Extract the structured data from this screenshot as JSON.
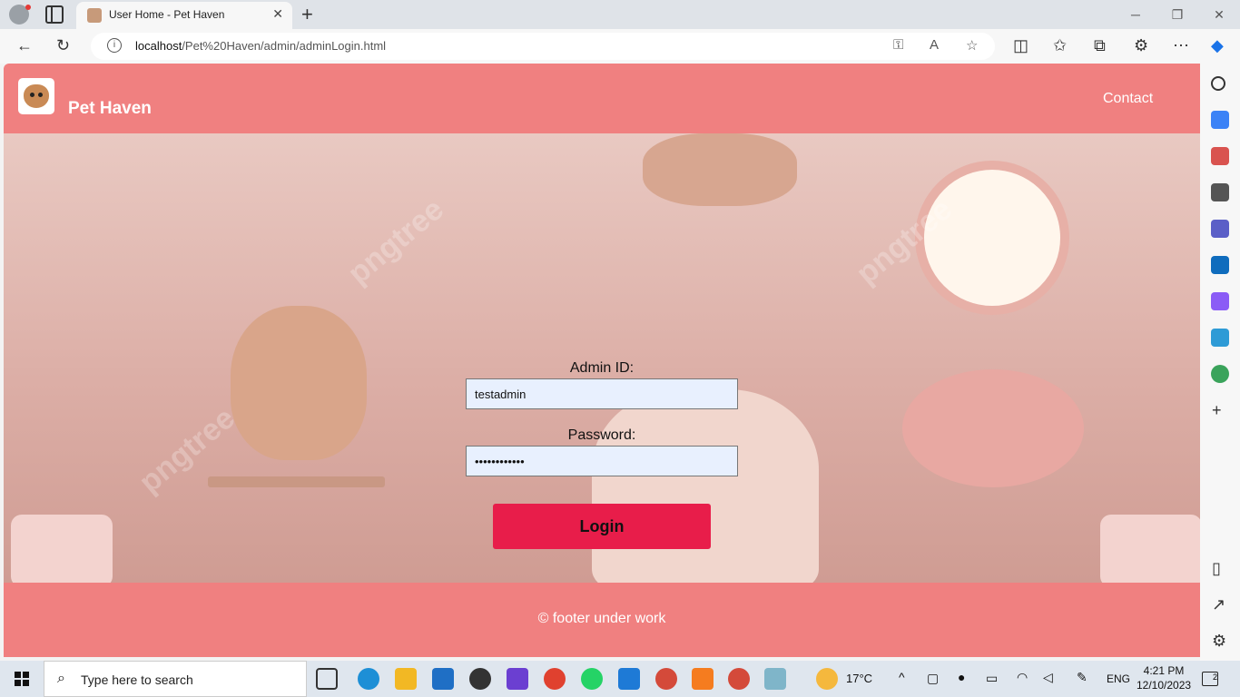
{
  "browser": {
    "tab_title": "User Home - Pet Haven",
    "url_host": "localhost",
    "url_path": "/Pet%20Haven/admin/adminLogin.html"
  },
  "site": {
    "name": "Pet Haven",
    "nav_contact": "Contact",
    "footer": "© footer under work"
  },
  "login_form": {
    "admin_id_label": "Admin ID:",
    "admin_id_value": "testadmin",
    "password_label": "Password:",
    "password_value": "••••••••••••",
    "login_button": "Login"
  },
  "taskbar": {
    "search_placeholder": "Type here to search",
    "weather": "17°C",
    "language": "ENG",
    "time": "4:21 PM",
    "date": "12/10/2023",
    "notifications": "2"
  },
  "colors": {
    "header_bg": "#f08080",
    "login_button": "#e81d4a"
  }
}
